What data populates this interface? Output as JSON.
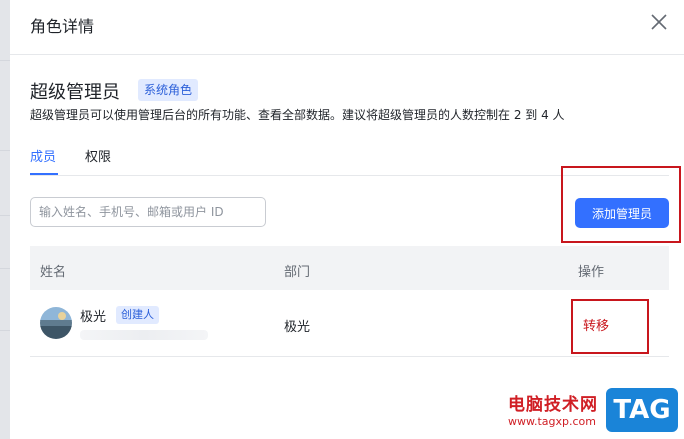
{
  "dialog": {
    "title": "角色详情",
    "role_name": "超级管理员",
    "role_badge": "系统角色",
    "description": "超级管理员可以使用管理后台的所有功能、查看全部数据。建议将超级管理员的人数控制在 2 到 4 人"
  },
  "tabs": [
    {
      "label": "成员",
      "active": true
    },
    {
      "label": "权限",
      "active": false
    }
  ],
  "search": {
    "placeholder": "输入姓名、手机号、邮箱或用户 ID",
    "value": ""
  },
  "add_button": {
    "label": "添加管理员"
  },
  "table": {
    "headers": {
      "name": "姓名",
      "department": "部门",
      "actions": "操作"
    },
    "rows": [
      {
        "name": "极光",
        "tag": "创建人",
        "department": "极光",
        "action": "转移"
      }
    ]
  },
  "watermark": {
    "text": "电脑技术网",
    "url": "www.tagxp.com",
    "tag": "TAG"
  },
  "colors": {
    "accent": "#3370ff",
    "highlight_box": "#c8161d",
    "action_text": "#c8161d"
  },
  "icons": {
    "close": "close-icon",
    "avatar": "avatar"
  }
}
